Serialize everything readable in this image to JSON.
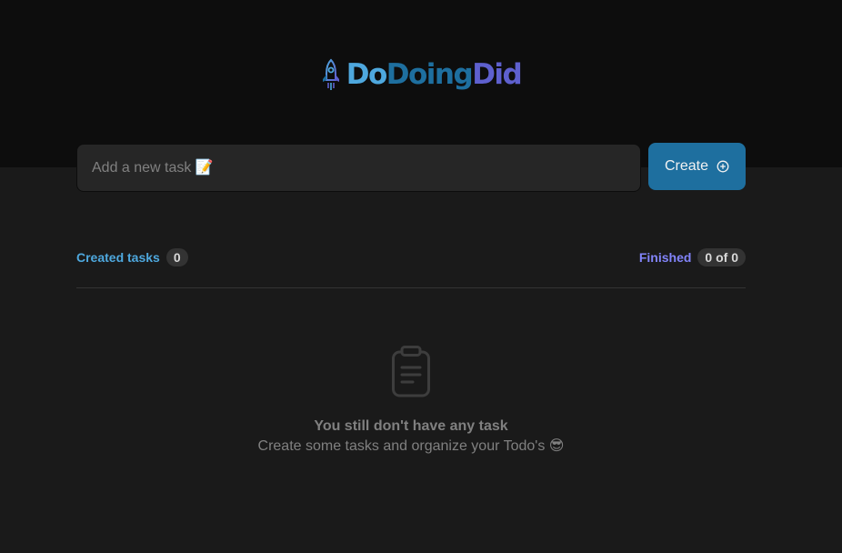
{
  "app": {
    "logo_parts": [
      "Do",
      "Doing",
      "Did"
    ],
    "icons": {
      "logo": "rocket-icon",
      "create": "plus-circle-icon",
      "empty": "clipboard-icon"
    }
  },
  "form": {
    "placeholder": "Add a new task 📝",
    "value": "",
    "create_label": "Create"
  },
  "summary": {
    "created_label": "Created tasks",
    "created_count": "0",
    "finished_label": "Finished",
    "finished_count": "0 of 0"
  },
  "empty": {
    "title": "You still don't have any task",
    "subtitle": "Create some tasks and organize your Todo's 😎"
  },
  "colors": {
    "header_bg": "#0d0d0d",
    "body_bg": "#1a1a1a",
    "input_bg": "#262626",
    "blue": "#4ea8de",
    "blue_dark": "#1e6f9f",
    "purple": "#5e60ce",
    "purple_light": "#8284fa",
    "gray": "#808080"
  }
}
